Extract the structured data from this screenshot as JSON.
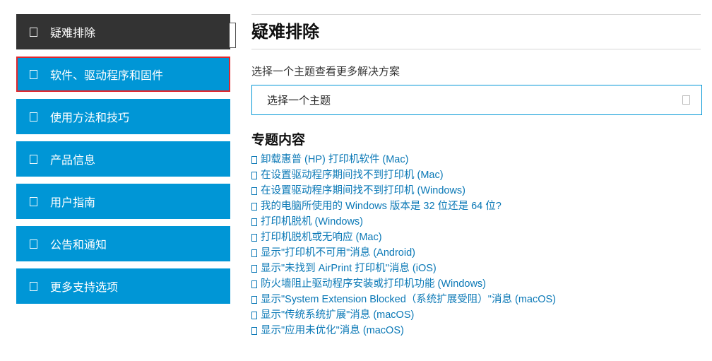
{
  "sidebar": {
    "items": [
      {
        "label": "疑难排除",
        "icon": "document-icon"
      },
      {
        "label": "软件、驱动程序和固件",
        "icon": "download-icon"
      },
      {
        "label": "使用方法和技巧",
        "icon": "lightbulb-icon"
      },
      {
        "label": "产品信息",
        "icon": "info-icon"
      },
      {
        "label": "用户指南",
        "icon": "book-icon"
      },
      {
        "label": "公告和通知",
        "icon": "megaphone-icon"
      },
      {
        "label": "更多支持选项",
        "icon": "support-icon"
      }
    ]
  },
  "main": {
    "title": "疑难排除",
    "prompt": "选择一个主题查看更多解决方案",
    "select": {
      "value": "选择一个主题",
      "icon": "chevron-down-icon"
    },
    "featured": {
      "title": "专题内容",
      "links": [
        "卸载惠普 (HP) 打印机软件 (Mac)",
        "在设置驱动程序期间找不到打印机 (Mac)",
        "在设置驱动程序期间找不到打印机 (Windows)",
        "我的电脑所使用的 Windows 版本是 32 位还是 64 位?",
        "打印机脱机 (Windows)",
        "打印机脱机或无响应 (Mac)",
        "显示\"打印机不可用\"消息 (Android)",
        "显示\"未找到 AirPrint 打印机\"消息 (iOS)",
        "防火墙阻止驱动程序安装或打印机功能 (Windows)",
        "显示\"System Extension Blocked（系统扩展受阻）\"消息 (macOS)",
        "显示\"传统系统扩展\"消息 (macOS)",
        "显示\"应用未优化\"消息 (macOS)"
      ]
    }
  },
  "colors": {
    "brand_blue": "#0096d6",
    "active_bg": "#333333",
    "focus_outline": "#e0262d",
    "link": "#0a78b6"
  }
}
